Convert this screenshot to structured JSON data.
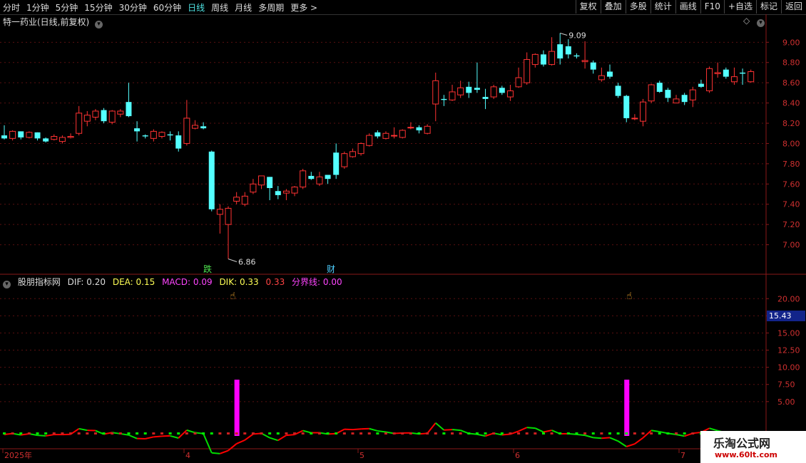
{
  "toolbar": {
    "periods": [
      "分时",
      "1分钟",
      "5分钟",
      "15分钟",
      "30分钟",
      "60分钟",
      "日线",
      "周线",
      "月线",
      "多周期",
      "更多 >"
    ],
    "active_period": "日线",
    "actions": [
      "复权",
      "叠加",
      "多股",
      "统计",
      "画线",
      "F10",
      "+自选",
      "标记",
      "返回"
    ]
  },
  "main_chart": {
    "title": "特一药业(日线,前复权)",
    "high_label": "9.09",
    "low_label": "6.86",
    "markers": [
      "跌",
      "财"
    ],
    "y_ticks": [
      "9.00",
      "8.80",
      "8.60",
      "8.40",
      "8.20",
      "8.00",
      "7.80",
      "7.60",
      "7.40",
      "7.20",
      "7.00"
    ]
  },
  "indicator": {
    "name": "股朋指标网",
    "dif_label": "DIF: 0.20",
    "dea_label": "DEA: 0.15",
    "macd_label": "MACD: 0.09",
    "dik_label": "DIK: 0.33",
    "extra_value": "0.33",
    "line_label": "分界线: 0.00",
    "y_ticks": [
      "20.00",
      "17.50",
      "15.00",
      "12.50",
      "10.00",
      "7.50",
      "5.00"
    ],
    "current_value": "15.43"
  },
  "time_axis": [
    "2025年",
    "4",
    "5",
    "6",
    "7"
  ],
  "watermark": {
    "line1": "乐淘公式网",
    "line2": "www.60lt.com"
  },
  "colors": {
    "up": "#ff3232",
    "down": "#54ffff",
    "magenta": "#ff00ff",
    "green": "#00dd00",
    "red": "#ff0000"
  },
  "chart_data": {
    "type": "candlestick",
    "ylim": [
      6.8,
      9.15
    ],
    "candles": [
      [
        8.08,
        8.05,
        8.18,
        8.04
      ],
      [
        8.05,
        8.12,
        8.13,
        8.03
      ],
      [
        8.12,
        8.06,
        8.12,
        8.04
      ],
      [
        8.06,
        8.11,
        8.12,
        8.05
      ],
      [
        8.11,
        8.05,
        8.11,
        8.03
      ],
      [
        8.05,
        8.02,
        8.06,
        8.01
      ],
      [
        8.04,
        8.07,
        8.09,
        8.03
      ],
      [
        8.02,
        8.06,
        8.08,
        8.0
      ],
      [
        8.06,
        8.07,
        8.1,
        8.05
      ],
      [
        8.1,
        8.3,
        8.37,
        8.08
      ],
      [
        8.22,
        8.28,
        8.32,
        8.17
      ],
      [
        8.26,
        8.32,
        8.34,
        8.23
      ],
      [
        8.33,
        8.22,
        8.35,
        8.2
      ],
      [
        8.21,
        8.32,
        8.33,
        8.19
      ],
      [
        8.29,
        8.32,
        8.34,
        8.26
      ],
      [
        8.41,
        8.27,
        8.6,
        8.26
      ],
      [
        8.15,
        8.12,
        8.22,
        8.02
      ],
      [
        8.08,
        8.07,
        8.09,
        8.05
      ],
      [
        8.05,
        8.12,
        8.14,
        8.02
      ],
      [
        8.07,
        8.11,
        8.12,
        8.05
      ],
      [
        8.09,
        8.08,
        8.12,
        8.03
      ],
      [
        8.08,
        7.95,
        8.12,
        7.92
      ],
      [
        8.0,
        8.25,
        8.43,
        7.98
      ],
      [
        8.15,
        8.18,
        8.23,
        8.14
      ],
      [
        8.17,
        8.15,
        8.21,
        8.14
      ],
      [
        7.92,
        7.35,
        7.93,
        7.33
      ],
      [
        7.3,
        7.35,
        7.4,
        7.11
      ],
      [
        7.2,
        7.36,
        7.38,
        6.86
      ],
      [
        7.43,
        7.47,
        7.52,
        7.4
      ],
      [
        7.4,
        7.48,
        7.52,
        7.38
      ],
      [
        7.52,
        7.6,
        7.65,
        7.5
      ],
      [
        7.59,
        7.68,
        7.68,
        7.55
      ],
      [
        7.67,
        7.56,
        7.67,
        7.44
      ],
      [
        7.53,
        7.49,
        7.58,
        7.45
      ],
      [
        7.51,
        7.53,
        7.55,
        7.44
      ],
      [
        7.51,
        7.57,
        7.58,
        7.48
      ],
      [
        7.57,
        7.73,
        7.75,
        7.55
      ],
      [
        7.68,
        7.65,
        7.72,
        7.64
      ],
      [
        7.6,
        7.67,
        7.72,
        7.58
      ],
      [
        7.69,
        7.65,
        7.67,
        7.6
      ],
      [
        7.91,
        7.69,
        8.0,
        7.65
      ],
      [
        7.77,
        7.9,
        7.92,
        7.75
      ],
      [
        7.87,
        7.92,
        7.95,
        7.86
      ],
      [
        7.9,
        8.0,
        8.01,
        7.88
      ],
      [
        7.98,
        8.08,
        8.1,
        7.97
      ],
      [
        8.11,
        8.07,
        8.13,
        8.05
      ],
      [
        8.05,
        8.1,
        8.12,
        8.04
      ],
      [
        8.08,
        8.08,
        8.16,
        8.05
      ],
      [
        8.06,
        8.13,
        8.14,
        8.05
      ],
      [
        8.16,
        8.16,
        8.21,
        8.14
      ],
      [
        8.16,
        8.13,
        8.18,
        8.1
      ],
      [
        8.1,
        8.17,
        8.19,
        8.09
      ],
      [
        8.39,
        8.62,
        8.7,
        8.22
      ],
      [
        8.44,
        8.43,
        8.48,
        8.37
      ],
      [
        8.43,
        8.51,
        8.58,
        8.42
      ],
      [
        8.48,
        8.55,
        8.62,
        8.45
      ],
      [
        8.56,
        8.5,
        8.61,
        8.45
      ],
      [
        8.55,
        8.53,
        8.8,
        8.5
      ],
      [
        8.46,
        8.44,
        8.54,
        8.34
      ],
      [
        8.46,
        8.56,
        8.58,
        8.44
      ],
      [
        8.55,
        8.5,
        8.57,
        8.48
      ],
      [
        8.46,
        8.52,
        8.58,
        8.42
      ],
      [
        8.56,
        8.65,
        8.75,
        8.55
      ],
      [
        8.6,
        8.83,
        8.9,
        8.58
      ],
      [
        8.78,
        8.88,
        8.89,
        8.75
      ],
      [
        8.88,
        8.78,
        8.92,
        8.76
      ],
      [
        8.78,
        8.91,
        9.05,
        8.77
      ],
      [
        8.98,
        8.84,
        9.09,
        8.78
      ],
      [
        8.96,
        8.88,
        9.03,
        8.84
      ],
      [
        8.87,
        8.86,
        8.89,
        8.84
      ],
      [
        8.81,
        8.82,
        9.01,
        8.74
      ],
      [
        8.8,
        8.73,
        8.82,
        8.69
      ],
      [
        8.63,
        8.67,
        8.75,
        8.61
      ],
      [
        8.71,
        8.66,
        8.78,
        8.64
      ],
      [
        8.57,
        8.47,
        8.6,
        8.45
      ],
      [
        8.47,
        8.25,
        8.48,
        8.21
      ],
      [
        8.25,
        8.25,
        8.29,
        8.23
      ],
      [
        8.22,
        8.41,
        8.44,
        8.17
      ],
      [
        8.42,
        8.58,
        8.59,
        8.4
      ],
      [
        8.6,
        8.51,
        8.62,
        8.5
      ],
      [
        8.53,
        8.45,
        8.55,
        8.41
      ],
      [
        8.4,
        8.44,
        8.48,
        8.42
      ],
      [
        8.48,
        8.41,
        8.5,
        8.38
      ],
      [
        8.43,
        8.53,
        8.56,
        8.36
      ],
      [
        8.59,
        8.56,
        8.63,
        8.55
      ],
      [
        8.52,
        8.74,
        8.76,
        8.5
      ],
      [
        8.69,
        8.7,
        8.8,
        8.65
      ],
      [
        8.73,
        8.66,
        8.75,
        8.64
      ],
      [
        8.61,
        8.66,
        8.75,
        8.58
      ],
      [
        8.7,
        8.69,
        8.74,
        8.58
      ],
      [
        8.61,
        8.71,
        8.73,
        8.6
      ]
    ],
    "indicator_spikes": [
      28,
      75
    ],
    "spike_value": 8.2,
    "indicator_ylim": [
      0,
      22
    ]
  }
}
